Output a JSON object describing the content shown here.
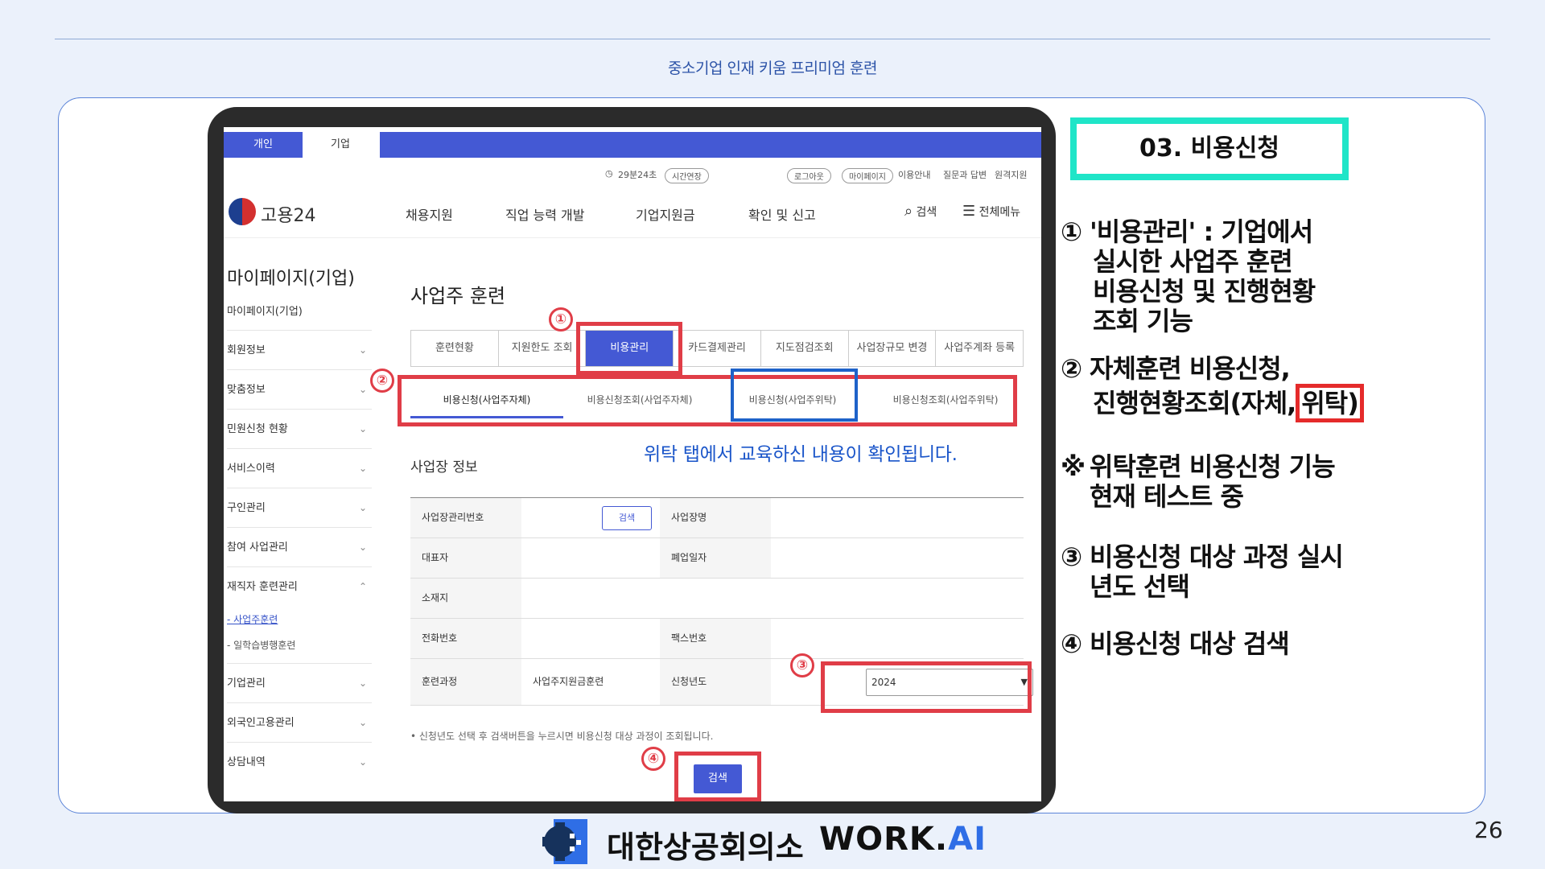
{
  "slide": {
    "subtitle": "중소기업 인재 키움 프리미엄 훈련",
    "page_number": "26"
  },
  "screen": {
    "user_tabs": [
      "개인",
      "기업"
    ],
    "util": {
      "timer": "29분24초",
      "extend": "시간연장",
      "logout": "로그아웃",
      "mypage": "마이페이지",
      "guide": "이용안내",
      "qna": "질문과 답변",
      "remote": "원격지원"
    },
    "logo_text": "고용24",
    "gnb": [
      "채용지원",
      "직업 능력 개발",
      "기업지원금",
      "확인 및 신고"
    ],
    "search_label": "검색",
    "menu_label": "전체메뉴",
    "sidebar": {
      "title": "마이페이지(기업)",
      "items": [
        "마이페이지(기업)",
        "회원정보",
        "맞춤정보",
        "민원신청 현황",
        "서비스이력",
        "구인관리",
        "참여 사업관리",
        "재직자 훈련관리",
        "기업관리",
        "외국인고용관리",
        "상담내역"
      ],
      "subitems": [
        "- 사업주훈련",
        "- 일학습병행훈련"
      ]
    },
    "content_title": "사업주 훈련",
    "tabs": [
      "훈련현황",
      "지원한도 조회",
      "비용관리",
      "카드결제관리",
      "지도점검조회",
      "사업장규모 변경",
      "사업주계좌 등록"
    ],
    "subtabs": [
      "비용신청(사업주자체)",
      "비용신청조회(사업주자체)",
      "비용신청(사업주위탁)",
      "비용신청조회(사업주위탁)"
    ],
    "blue_note": "위탁 탭에서 교육하신 내용이 확인됩니다.",
    "section_title": "사업장 정보",
    "form": {
      "biz_no_label": "사업장관리번호",
      "check_btn": "검색",
      "biz_name_label": "사업장명",
      "ceo_label": "대표자",
      "close_label": "폐업일자",
      "address_label": "소재지",
      "phone_label": "전화번호",
      "fax_label": "팩스번호",
      "course_label": "훈련과정",
      "course_value": "사업주지원금훈련",
      "year_label": "신청년도",
      "year_value": "2024"
    },
    "hint": "• 신청년도 선택 후 검색버튼을 누르시면 비용신청 대상 과정이 조회됩니다.",
    "search_btn": "검색",
    "circle_nums": [
      "①",
      "②",
      "③",
      "④"
    ]
  },
  "explanation": {
    "title": "03. 비용신청",
    "items": [
      {
        "marker": "①",
        "lines": [
          "'비용관리' : 기업에서",
          "실시한 사업주 훈련",
          "비용신청 및 진행현황",
          "조회 기능"
        ]
      },
      {
        "marker": "②",
        "line1": "자체훈련 비용신청,",
        "line2a": "진행현황조회(자체,",
        "line2b": "위탁)"
      },
      {
        "marker": "※",
        "lines": [
          "위탁훈련 비용신청 기능",
          "현재 테스트 중"
        ]
      },
      {
        "marker": "③",
        "lines": [
          "비용신청 대상 과정 실시",
          "년도 선택"
        ]
      },
      {
        "marker": "④",
        "lines": [
          "비용신청 대상 검색"
        ]
      }
    ]
  },
  "footer": {
    "org_kr": "대한상공회의소",
    "brand_a": "WORK.",
    "brand_b": "AI"
  },
  "colors": {
    "accent_blue": "#4459d4",
    "highlight_red": "#e03d47",
    "highlight_teal": "#1fe5c8",
    "note_blue": "#1a55c9"
  }
}
